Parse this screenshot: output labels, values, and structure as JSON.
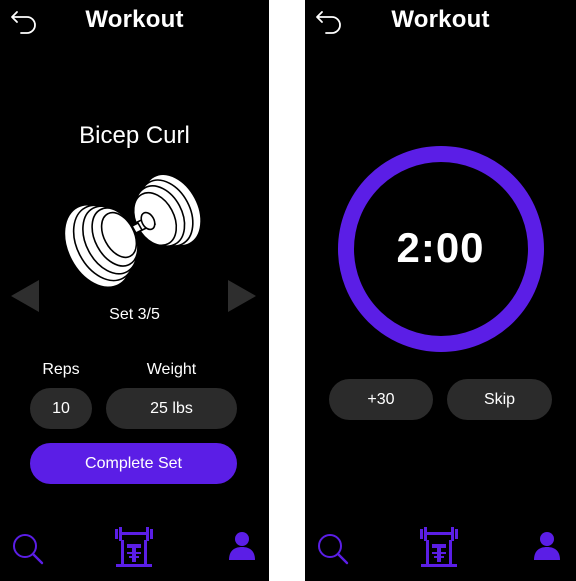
{
  "left_screen": {
    "title": "Workout",
    "exercise_name": "Bicep Curl",
    "set_label": "Set 3/5",
    "reps_label": "Reps",
    "reps_value": "10",
    "weight_label": "Weight",
    "weight_value": "25 lbs",
    "complete_button": "Complete Set",
    "icons": [
      "back-arrow-icon",
      "dumbbell-icon",
      "left-arrow-icon",
      "right-arrow-icon",
      "search-icon",
      "workout-bench-icon",
      "profile-icon"
    ]
  },
  "right_screen": {
    "title": "Workout",
    "timer": "2:00",
    "add_time_button": "+30",
    "skip_button": "Skip",
    "icons": [
      "back-arrow-icon",
      "timer-ring",
      "search-icon",
      "workout-bench-icon",
      "profile-icon"
    ]
  },
  "colors": {
    "accent": "#5b1ee6",
    "background": "#000000",
    "pill": "#2b2b2b",
    "arrow": "#2e2e2e",
    "text": "#ffffff"
  }
}
